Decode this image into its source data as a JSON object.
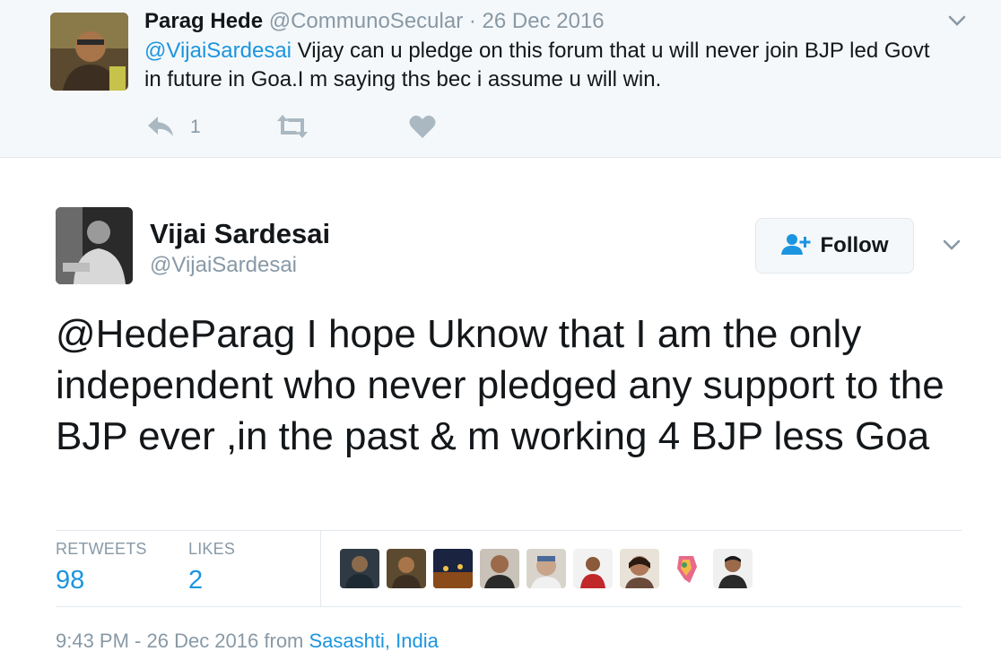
{
  "parent_tweet": {
    "name": "Parag Hede",
    "handle": "@CommunoSecular",
    "separator": "·",
    "date": "26 Dec 2016",
    "mention": "@VijaiSardesai",
    "text": " Vijay can u pledge on this forum that u will never join BJP led Govt in future in Goa.I m saying ths bec i assume u will win.",
    "reply_count": "1",
    "icons": [
      "reply-icon",
      "retweet-icon",
      "heart-icon",
      "chevron-down-icon"
    ]
  },
  "main_tweet": {
    "name": "Vijai Sardesai",
    "handle": "@VijaiSardesai",
    "follow_label": "Follow",
    "text": "@HedeParag I hope Uknow that I am the only independent who never pledged any support to the BJP ever ,in the past & m working 4 BJP less Goa",
    "stats": {
      "retweets_label": "RETWEETS",
      "retweets_value": "98",
      "likes_label": "LIKES",
      "likes_value": "2"
    },
    "liker_avatars": [
      "avatar",
      "avatar",
      "avatar",
      "avatar",
      "avatar",
      "avatar",
      "avatar",
      "avatar",
      "avatar"
    ],
    "timestamp": "9:43 PM - 26 Dec 2016",
    "from_label": "from",
    "location": "Sasashti, India"
  },
  "colors": {
    "accent": "#1b95e0",
    "muted": "#8899a6",
    "text": "#14171a",
    "parent_bg": "#f5f8fa"
  }
}
